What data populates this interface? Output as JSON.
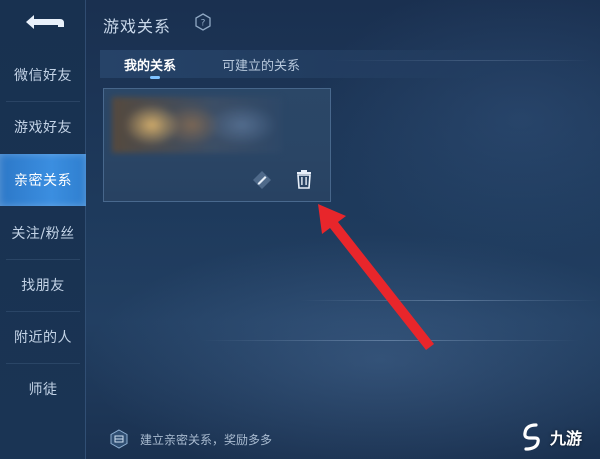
{
  "header": {
    "title": "游戏关系"
  },
  "sidebar": {
    "items": [
      {
        "label": "微信好友",
        "active": false
      },
      {
        "label": "游戏好友",
        "active": false
      },
      {
        "label": "亲密关系",
        "active": true
      },
      {
        "label": "关注/粉丝",
        "active": false
      },
      {
        "label": "找朋友",
        "active": false
      },
      {
        "label": "附近的人",
        "active": false
      },
      {
        "label": "师徒",
        "active": false
      }
    ]
  },
  "tabs": [
    {
      "label": "我的关系",
      "active": true
    },
    {
      "label": "可建立的关系",
      "active": false
    }
  ],
  "card": {
    "actions": [
      "edit-icon",
      "trash-icon"
    ]
  },
  "footer": {
    "hint": "建立亲密关系，奖励多多"
  },
  "watermark": {
    "text": "九游"
  },
  "colors": {
    "accent": "#3b8ee0",
    "annotation_arrow": "#e8262b",
    "background": "#1e3a5c"
  }
}
